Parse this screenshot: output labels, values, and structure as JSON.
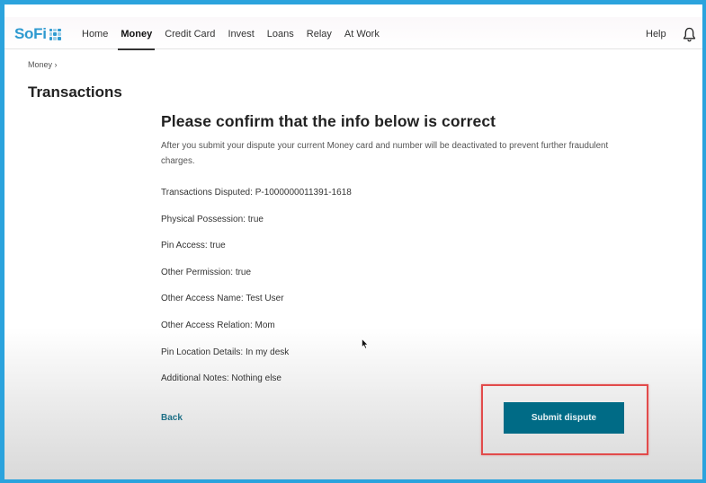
{
  "header": {
    "logo_text": "SoFi",
    "nav": [
      {
        "label": "Home",
        "active": false
      },
      {
        "label": "Money",
        "active": true
      },
      {
        "label": "Credit Card",
        "active": false
      },
      {
        "label": "Invest",
        "active": false
      },
      {
        "label": "Loans",
        "active": false
      },
      {
        "label": "Relay",
        "active": false
      },
      {
        "label": "At Work",
        "active": false
      }
    ],
    "help_label": "Help",
    "notification_icon": "bell-icon"
  },
  "breadcrumb": {
    "items": [
      "Money"
    ],
    "separator": "›"
  },
  "page_title": "Transactions",
  "confirm": {
    "heading": "Please confirm that the info below is correct",
    "intro": "After you submit your dispute your current Money card and number will be deactivated to prevent further fraudulent charges.",
    "details": [
      {
        "label": "Transactions Disputed",
        "value": "P-1000000011391-1618"
      },
      {
        "label": "Physical Possession",
        "value": "true"
      },
      {
        "label": "Pin Access",
        "value": "true"
      },
      {
        "label": "Other Permission",
        "value": "true"
      },
      {
        "label": "Other Access Name",
        "value": "Test User"
      },
      {
        "label": "Other Access Relation",
        "value": "Mom"
      },
      {
        "label": "Pin Location Details",
        "value": "In my desk"
      },
      {
        "label": "Additional Notes",
        "value": "Nothing else"
      }
    ]
  },
  "actions": {
    "back_label": "Back",
    "submit_label": "Submit dispute"
  },
  "colors": {
    "brand": "#2e9ad0",
    "primary_button": "#006b86",
    "link": "#1d6f86",
    "annotation_highlight": "#e24b4b",
    "frame_border": "#2ba3dd"
  }
}
